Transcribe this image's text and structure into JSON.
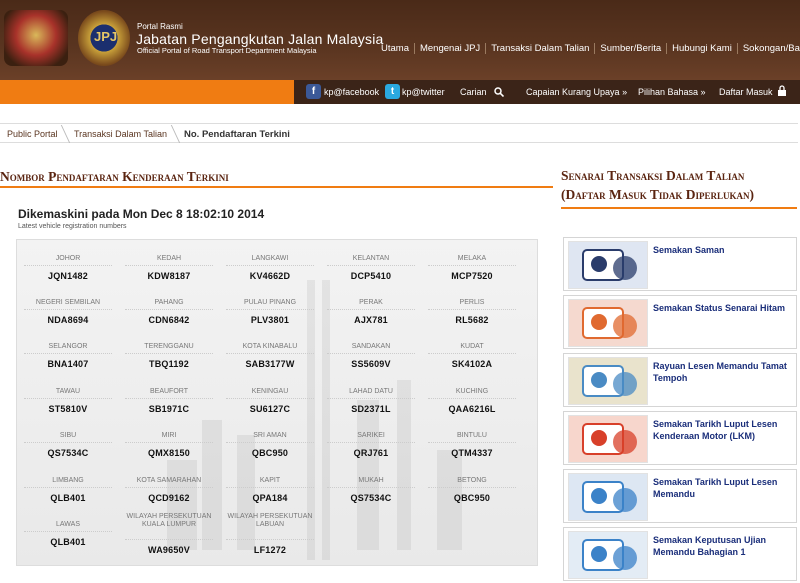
{
  "header": {
    "portal_small": "Portal Rasmi",
    "title": "Jabatan Pengangkutan Jalan Malaysia",
    "subtitle": "Official Portal of Road Transport Department Malaysia",
    "logo_text": "JPJ",
    "nav": [
      "Utama",
      "Mengenai JPJ",
      "Transaksi Dalam Talian",
      "Sumber/Berita",
      "Hubungi Kami",
      "Sokongan/Bantuan"
    ]
  },
  "toolbar": {
    "facebook": "kp@facebook",
    "twitter": "kp@twitter",
    "search": "Carian",
    "accessibility": "Capaian Kurang Upaya »",
    "language": "Pilihan Bahasa »",
    "login": "Daftar Masuk"
  },
  "breadcrumb": [
    "Public Portal",
    "Transaksi Dalam Talian",
    "No. Pendaftaran Terkini"
  ],
  "main": {
    "heading": "Nombor Pendaftaran Kenderaan Terkini",
    "updated": "Dikemaskini pada Mon Dec 8 18:02:10 2014",
    "updated_sub": "Latest vehicle registration numbers",
    "states": [
      {
        "state": "JOHOR",
        "plate": "JQN1482"
      },
      {
        "state": "KEDAH",
        "plate": "KDW8187"
      },
      {
        "state": "LANGKAWI",
        "plate": "KV4662D"
      },
      {
        "state": "KELANTAN",
        "plate": "DCP5410"
      },
      {
        "state": "MELAKA",
        "plate": "MCP7520"
      },
      {
        "state": "NEGERI SEMBILAN",
        "plate": "NDA8694"
      },
      {
        "state": "PAHANG",
        "plate": "CDN6842"
      },
      {
        "state": "PULAU PINANG",
        "plate": "PLV3801"
      },
      {
        "state": "PERAK",
        "plate": "AJX781"
      },
      {
        "state": "PERLIS",
        "plate": "RL5682"
      },
      {
        "state": "SELANGOR",
        "plate": "BNA1407"
      },
      {
        "state": "TERENGGANU",
        "plate": "TBQ1192"
      },
      {
        "state": "KOTA KINABALU",
        "plate": "SAB3177W"
      },
      {
        "state": "SANDAKAN",
        "plate": "SS5609V"
      },
      {
        "state": "KUDAT",
        "plate": "SK4102A"
      },
      {
        "state": "TAWAU",
        "plate": "ST5810V"
      },
      {
        "state": "BEAUFORT",
        "plate": "SB1971C"
      },
      {
        "state": "KENINGAU",
        "plate": "SU6127C"
      },
      {
        "state": "LAHAD DATU",
        "plate": "SD2371L"
      },
      {
        "state": "KUCHING",
        "plate": "QAA6216L"
      },
      {
        "state": "SIBU",
        "plate": "QS7534C"
      },
      {
        "state": "MIRI",
        "plate": "QMX8150"
      },
      {
        "state": "SRI AMAN",
        "plate": "QBC950"
      },
      {
        "state": "SARIKEI",
        "plate": "QRJ761"
      },
      {
        "state": "BINTULU",
        "plate": "QTM4337"
      },
      {
        "state": "LIMBANG",
        "plate": "QLB401"
      },
      {
        "state": "KOTA SAMARAHAN",
        "plate": "QCD9162"
      },
      {
        "state": "KAPIT",
        "plate": "QPA184"
      },
      {
        "state": "MUKAH",
        "plate": "QS7534C"
      },
      {
        "state": "BETONG",
        "plate": "QBC950"
      },
      {
        "state": "LAWAS",
        "plate": "QLB401"
      },
      {
        "state": "WILAYAH PERSEKUTUAN KUALA LUMPUR",
        "plate": "WA9650V"
      },
      {
        "state": "WILAYAH PERSEKUTUAN LABUAN",
        "plate": "LF1272"
      }
    ]
  },
  "sidebar": {
    "heading_line1": "Senarai Transaksi Dalam Talian",
    "heading_line2": "(Daftar Masuk Tidak Diperlukan)",
    "items": [
      {
        "label": "Semakan Saman",
        "icon": "police-officer-icon"
      },
      {
        "label": "Semakan Status Senarai Hitam",
        "icon": "locked-car-icon"
      },
      {
        "label": "Rayuan Lesen Memandu Tamat Tempoh",
        "icon": "license-scales-icon"
      },
      {
        "label": "Semakan Tarikh Luput Lesen Kenderaan Motor (LKM)",
        "icon": "car-license-check-icon"
      },
      {
        "label": "Semakan Tarikh Luput Lesen Memandu",
        "icon": "driving-license-check-icon"
      },
      {
        "label": "Semakan Keputusan Ujian Memandu Bahagian 1",
        "icon": "test-result-icon"
      }
    ]
  },
  "colors": {
    "brown": "#4a2a18",
    "orange": "#f07c12",
    "heading": "#5a2410",
    "link": "#1a2e7a"
  }
}
